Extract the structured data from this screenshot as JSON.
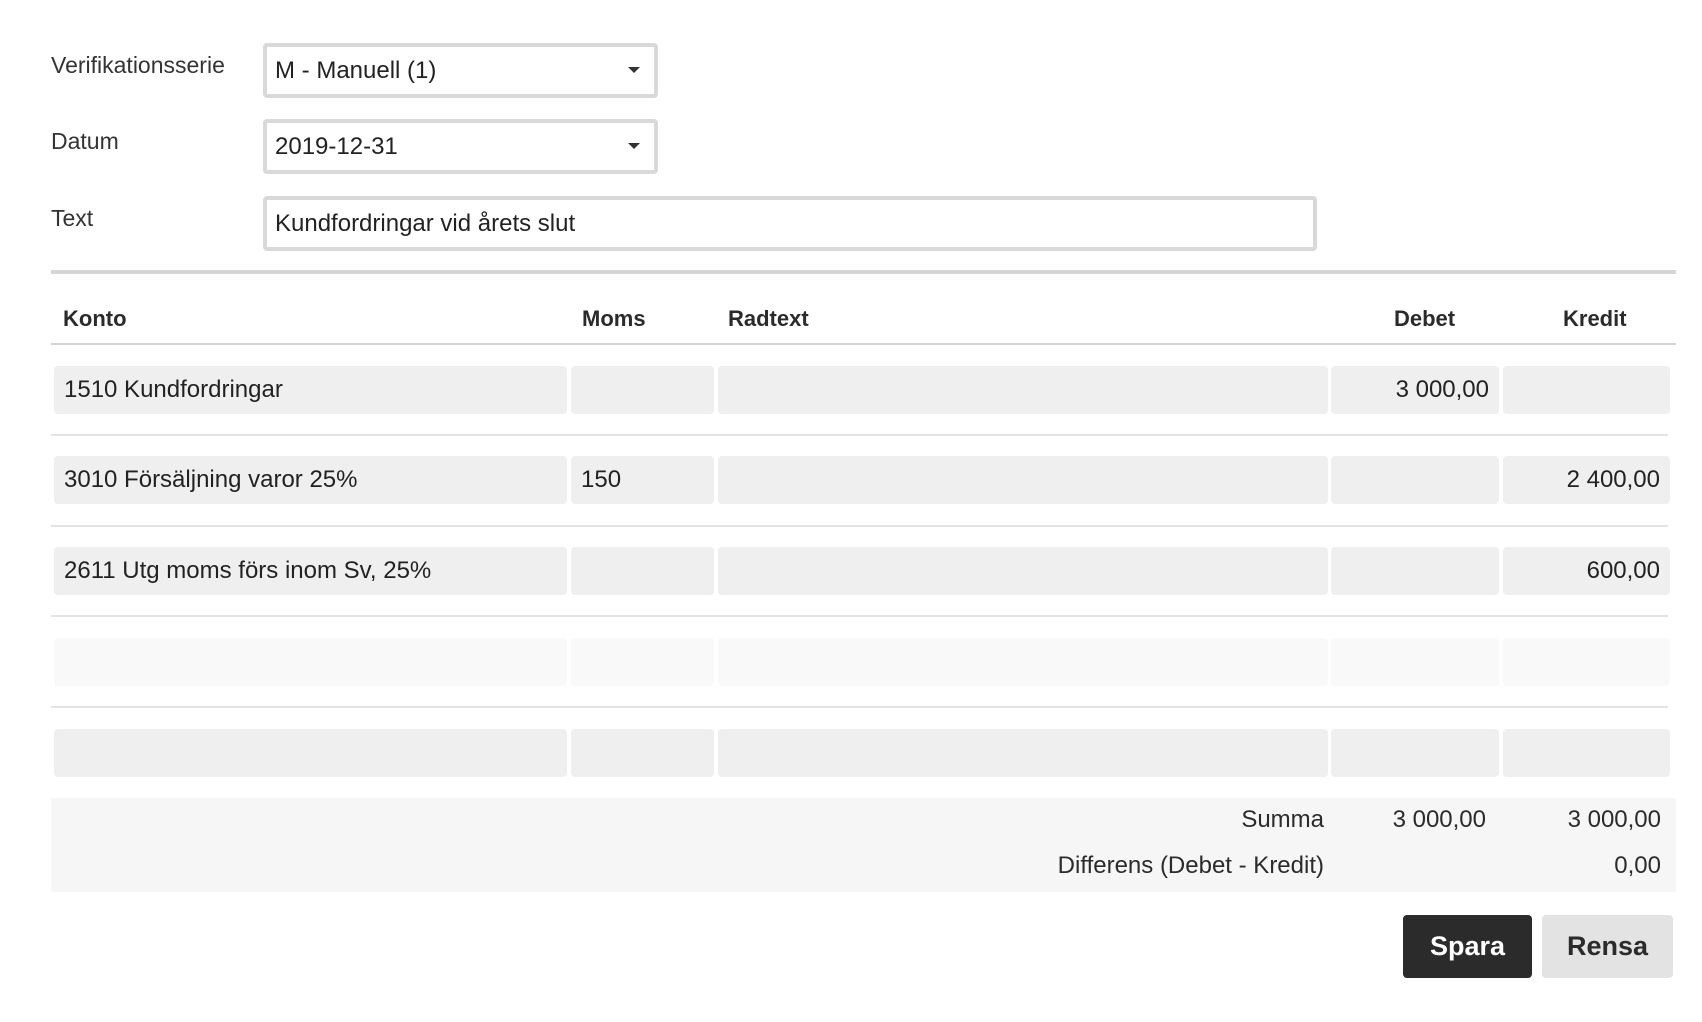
{
  "form": {
    "series_label": "Verifikationsserie",
    "series_value": "M - Manuell (1)",
    "date_label": "Datum",
    "date_value": "2019-12-31",
    "text_label": "Text",
    "text_value": "Kundfordringar vid årets slut"
  },
  "table": {
    "headers": {
      "konto": "Konto",
      "moms": "Moms",
      "radtext": "Radtext",
      "debet": "Debet",
      "kredit": "Kredit"
    },
    "rows": [
      {
        "konto": "1510 Kundfordringar",
        "moms": "",
        "radtext": "",
        "debet": "3 000,00",
        "kredit": ""
      },
      {
        "konto": "3010 Försäljning varor 25%",
        "moms": "150",
        "radtext": "",
        "debet": "",
        "kredit": "2 400,00"
      },
      {
        "konto": "2611 Utg moms förs inom Sv, 25%",
        "moms": "",
        "radtext": "",
        "debet": "",
        "kredit": "600,00"
      },
      {
        "konto": "",
        "moms": "",
        "radtext": "",
        "debet": "",
        "kredit": ""
      },
      {
        "konto": "",
        "moms": "",
        "radtext": "",
        "debet": "",
        "kredit": ""
      }
    ]
  },
  "summary": {
    "sum_label": "Summa",
    "sum_debet": "3 000,00",
    "sum_kredit": "3 000,00",
    "diff_label": "Differens (Debet - Kredit)",
    "diff_value": "0,00"
  },
  "actions": {
    "save_label": "Spara",
    "reset_label": "Rensa"
  },
  "icons": {
    "dropdown": "chevron-down-icon"
  }
}
